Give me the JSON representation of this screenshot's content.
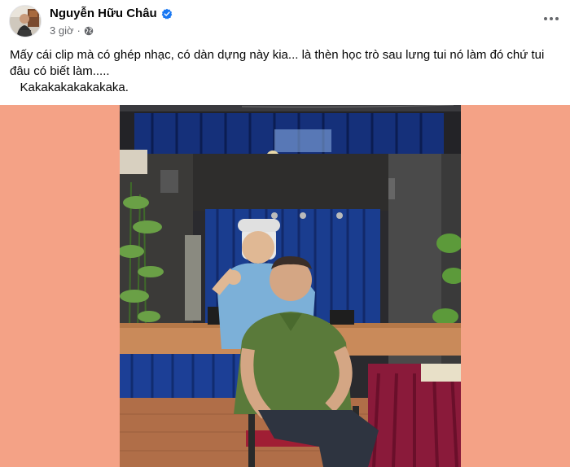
{
  "post": {
    "author_name": "Nguyễn Hữu Châu",
    "timestamp": "3 giờ",
    "separator": "·",
    "text_line1": "Mấy cái clip mà có ghép nhạc, có dàn dựng này kia... là thèn học trò sau lưng tui nó làm đó chứ tui đâu có biết làm.....",
    "text_line2": "   Kakakakakakakaka."
  },
  "icons": {
    "verified": "verified-badge-icon",
    "audience": "globe-icon",
    "more": "more-options-icon"
  },
  "colors": {
    "verified_blue": "#1877f2",
    "meta_gray": "#65676b",
    "photo_background": "#f4a286",
    "curtain_blue": "#1a3d8f",
    "tablecloth": "#8a1a3a",
    "shirt_green": "#5a7a3a"
  }
}
